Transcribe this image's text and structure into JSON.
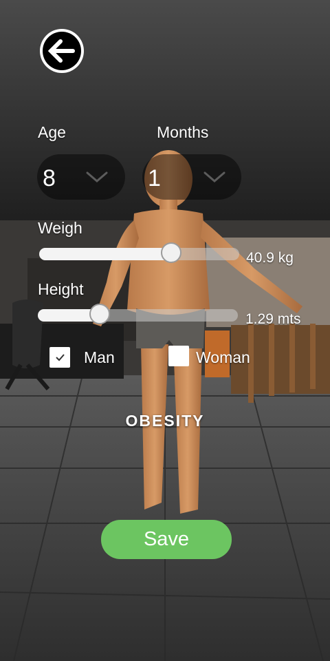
{
  "header": {
    "back_icon": "arrow-left-icon"
  },
  "age": {
    "label": "Age",
    "value": "8"
  },
  "months": {
    "label": "Months",
    "value": "1"
  },
  "weight": {
    "label": "Weigh",
    "value_text": "40.9 kg",
    "level": 0.66
  },
  "height": {
    "label": "Height",
    "value_text": "1.29 mts",
    "level": 0.31
  },
  "gender": {
    "options": [
      {
        "label": "Man",
        "checked": true
      },
      {
        "label": "Woman",
        "checked": false
      }
    ]
  },
  "status_text": "OBESITY",
  "save": {
    "label": "Save",
    "color": "#6cc561"
  }
}
